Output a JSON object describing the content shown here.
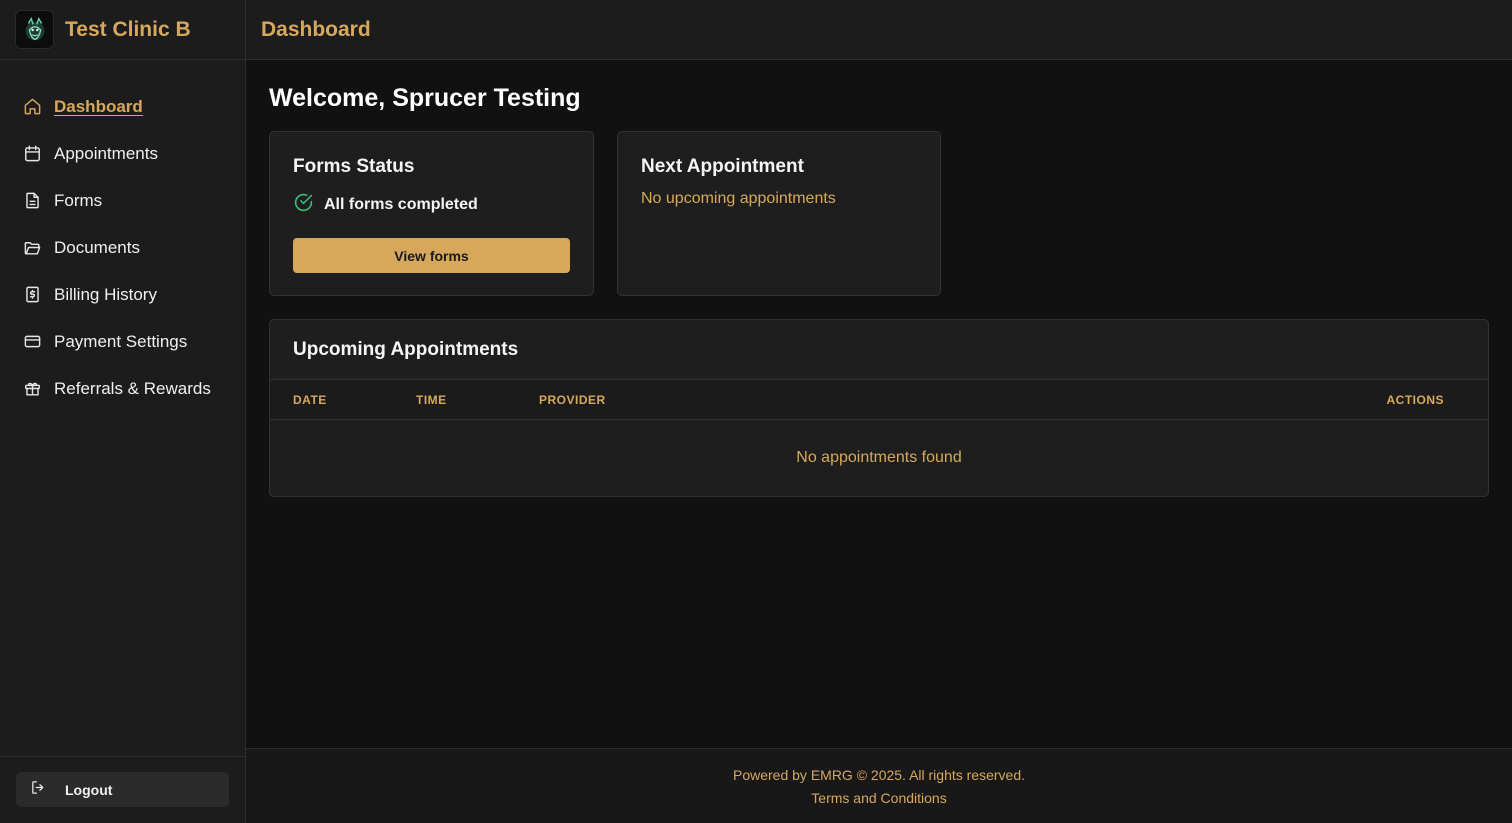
{
  "brand": {
    "name": "Test Clinic B",
    "logo_icon": "dragon-logo-icon"
  },
  "header": {
    "title": "Dashboard"
  },
  "sidebar": {
    "items": [
      {
        "label": "Dashboard",
        "icon": "home-icon",
        "active": true
      },
      {
        "label": "Appointments",
        "icon": "calendar-icon",
        "active": false
      },
      {
        "label": "Forms",
        "icon": "document-icon",
        "active": false
      },
      {
        "label": "Documents",
        "icon": "folder-icon",
        "active": false
      },
      {
        "label": "Billing History",
        "icon": "receipt-dollar-icon",
        "active": false
      },
      {
        "label": "Payment Settings",
        "icon": "credit-card-icon",
        "active": false
      },
      {
        "label": "Referrals & Rewards",
        "icon": "gift-icon",
        "active": false
      }
    ],
    "logout_label": "Logout"
  },
  "main": {
    "welcome": "Welcome, Sprucer Testing",
    "forms_card": {
      "title": "Forms Status",
      "status": "All forms completed",
      "button_label": "View forms"
    },
    "next_card": {
      "title": "Next Appointment",
      "empty_text": "No upcoming appointments"
    },
    "upcoming": {
      "title": "Upcoming Appointments",
      "columns": [
        "DATE",
        "TIME",
        "PROVIDER",
        "ACTIONS"
      ],
      "empty_text": "No appointments found"
    }
  },
  "footer": {
    "copyright": "Powered by EMRG © 2025. All rights reserved.",
    "terms_link": "Terms and Conditions"
  },
  "colors": {
    "accent": "#d7a85c",
    "success": "#3fbf7f",
    "background": "#111111",
    "panel": "#1c1c1c"
  }
}
